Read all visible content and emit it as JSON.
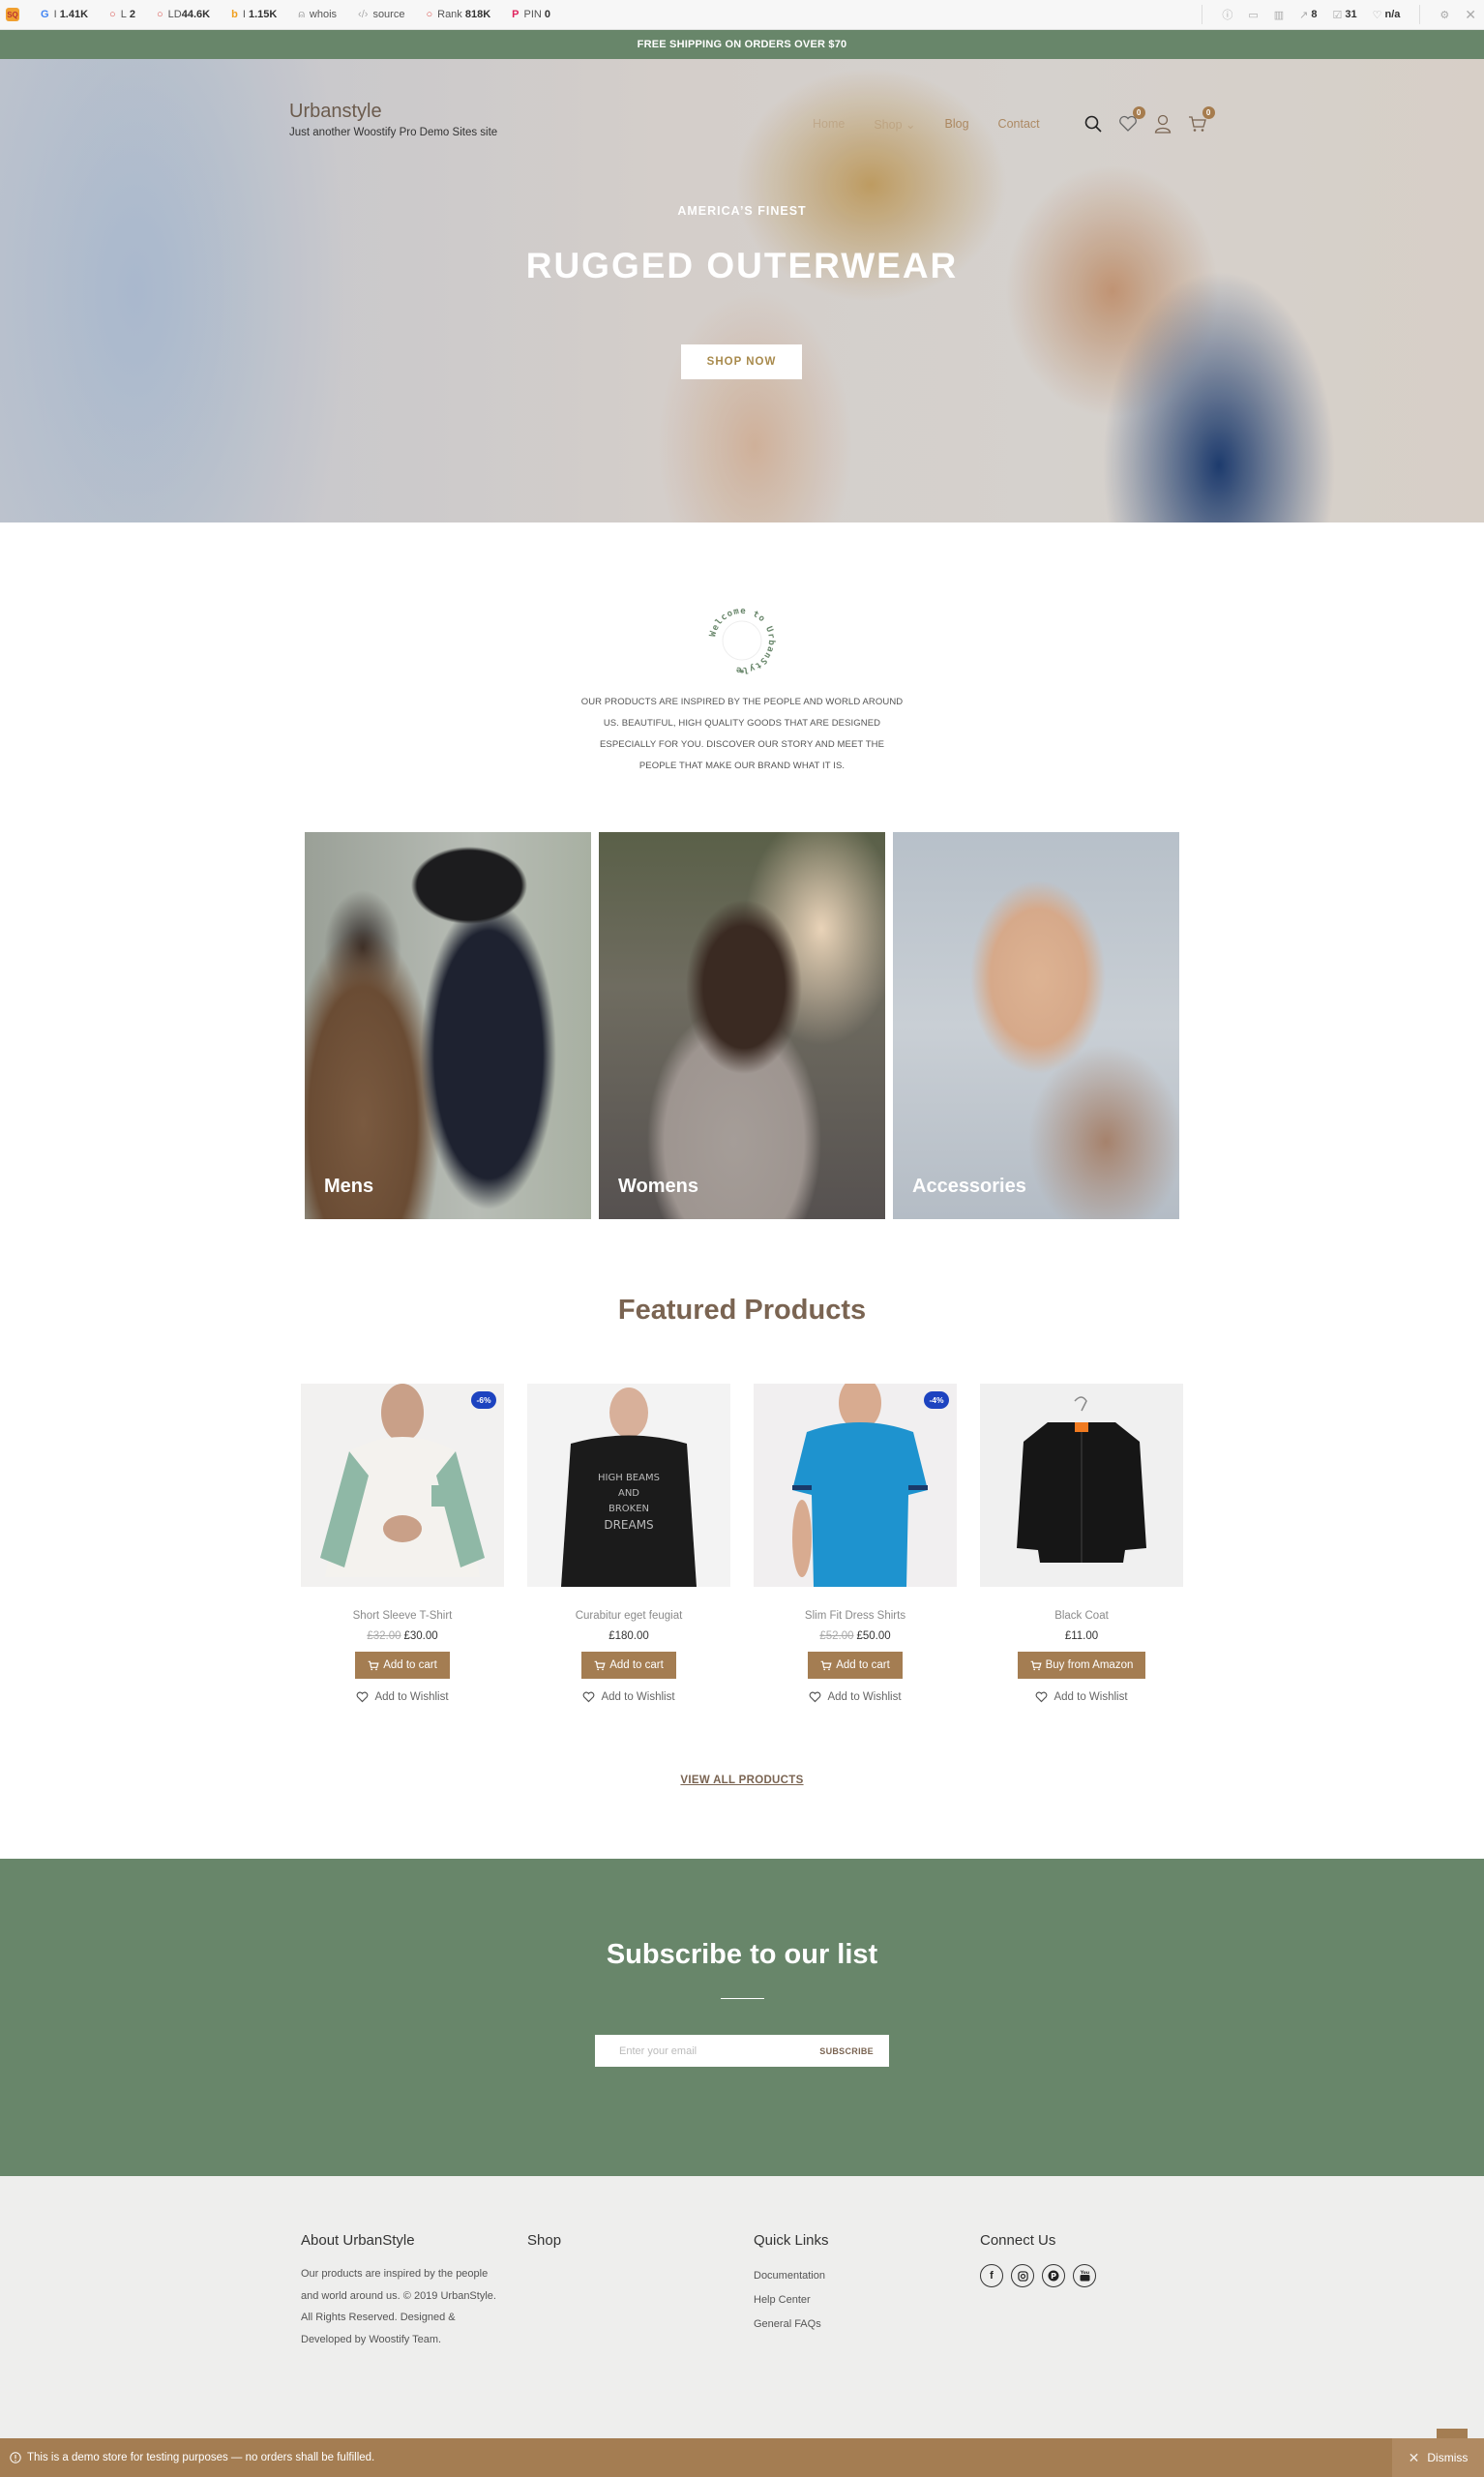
{
  "seo_toolbar": {
    "items": [
      {
        "icon": "google-icon",
        "label": "I",
        "value": "1.41K"
      },
      {
        "icon": "circle-icon",
        "label": "L",
        "value": "2"
      },
      {
        "icon": "circle-icon",
        "label": "LD",
        "value": "44.6K"
      },
      {
        "icon": "bing-icon",
        "label": "I",
        "value": "1.15K"
      },
      {
        "icon": "person-icon",
        "label": "whois",
        "value": ""
      },
      {
        "icon": "code-icon",
        "label": "source",
        "value": ""
      },
      {
        "icon": "circle-icon",
        "label": "Rank",
        "value": "818K"
      },
      {
        "icon": "pinterest-icon",
        "label": "PIN",
        "value": "0"
      }
    ],
    "right_items": [
      {
        "icon": "info-icon",
        "value": ""
      },
      {
        "icon": "monitor-icon",
        "value": ""
      },
      {
        "icon": "chart-icon",
        "value": ""
      },
      {
        "icon": "external-link-icon",
        "value": "8"
      },
      {
        "icon": "checkbox-icon",
        "value": "31"
      },
      {
        "icon": "heart-icon",
        "value": "n/a"
      }
    ]
  },
  "shipping_bar": {
    "text": "FREE SHIPPING ON ORDERS OVER $70"
  },
  "header": {
    "site_name": "Urbanstyle",
    "tagline": "Just another Woostify Pro Demo Sites site",
    "nav": [
      "Home",
      "Shop",
      "Blog",
      "Contact"
    ],
    "wishlist_count": "0",
    "cart_count": "0"
  },
  "hero": {
    "subtitle": "AMERICA’S FINEST",
    "title": "RUGGED OUTERWEAR",
    "button": "SHOP NOW"
  },
  "welcome": {
    "circle_text": "Welcome to UrbanStyle",
    "paragraph": "OUR PRODUCTS ARE INSPIRED BY THE PEOPLE AND WORLD AROUND US. BEAUTIFUL, HIGH QUALITY GOODS THAT ARE DESIGNED ESPECIALLY FOR YOU. DISCOVER OUR STORY AND MEET THE PEOPLE THAT MAKE OUR BRAND WHAT IT IS."
  },
  "categories": [
    {
      "label": "Mens"
    },
    {
      "label": "Womens"
    },
    {
      "label": "Accessories"
    }
  ],
  "featured": {
    "title": "Featured Products",
    "products": [
      {
        "name": "Short Sleeve T-Shirt",
        "old_price": "£32.00",
        "price": "£30.00",
        "badge": "-6%",
        "button": "Add to cart",
        "wishlist": "Add to Wishlist"
      },
      {
        "name": "Curabitur eget feugiat",
        "old_price": "",
        "price": "£180.00",
        "badge": "",
        "button": "Add to cart",
        "wishlist": "Add to Wishlist"
      },
      {
        "name": "Slim Fit Dress Shirts",
        "old_price": "£52.00",
        "price": "£50.00",
        "badge": "-4%",
        "button": "Add to cart",
        "wishlist": "Add to Wishlist"
      },
      {
        "name": "Black Coat",
        "old_price": "",
        "price": "£11.00",
        "badge": "",
        "button": "Buy from Amazon",
        "wishlist": "Add to Wishlist"
      }
    ],
    "view_all": "VIEW ALL PRODUCTS"
  },
  "subscribe": {
    "title": "Subscribe to our list",
    "placeholder": "Enter your email",
    "button": "SUBSCRIBE"
  },
  "footer": {
    "about_title": "About UrbanStyle",
    "about_text": "Our products are inspired by the people and world around us. © 2019 UrbanStyle. All Rights Reserved. Designed & Developed by Woostify Team.",
    "shop_title": "Shop",
    "quick_title": "Quick Links",
    "quick_links": [
      "Documentation",
      "Help Center",
      "General FAQs"
    ],
    "connect_title": "Connect Us",
    "socials": [
      "facebook",
      "instagram",
      "pinterest",
      "youtube"
    ]
  },
  "store_notice": {
    "text": "This is a demo store for testing purposes — no orders shall be fulfilled.",
    "dismiss": "Dismiss"
  },
  "colors": {
    "green": "#68866a",
    "brown": "#a47d52",
    "title_brown": "#7a6452",
    "sale_blue": "#1d43c0"
  }
}
